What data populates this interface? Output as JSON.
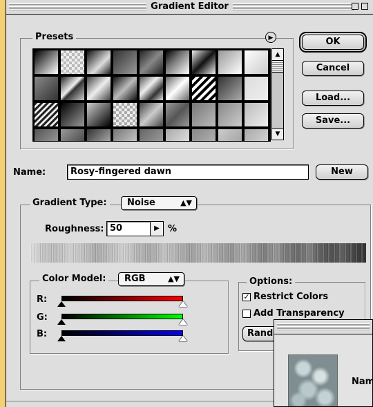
{
  "window": {
    "title": "Gradient Editor"
  },
  "presets": {
    "label": "Presets",
    "menu_icon": "circle-arrow-icon"
  },
  "buttons": {
    "ok": "OK",
    "cancel": "Cancel",
    "load": "Load...",
    "save": "Save...",
    "new": "New"
  },
  "name": {
    "label": "Name:",
    "value": "Rosy-fingered dawn"
  },
  "gradient_type": {
    "label": "Gradient Type:",
    "value": "Noise"
  },
  "roughness": {
    "label": "Roughness:",
    "value": "50",
    "unit": "%"
  },
  "color_model": {
    "label": "Color Model:",
    "value": "RGB",
    "channels": [
      {
        "label": "R:",
        "gradient": [
          "#000000",
          "#ff0000"
        ]
      },
      {
        "label": "G:",
        "gradient": [
          "#000000",
          "#00ff00"
        ]
      },
      {
        "label": "B:",
        "gradient": [
          "#000000",
          "#0000ff"
        ]
      }
    ]
  },
  "options": {
    "label": "Options:",
    "restrict_colors": {
      "label": "Restrict Colors",
      "checked": true
    },
    "add_transparency": {
      "label": "Add Transparency",
      "checked": false
    },
    "randomize": "Randomize"
  },
  "overlay_dialog": {
    "name_label": "Name"
  },
  "colors": {
    "desktop": "#f4cf76",
    "window_bg": "#dedede"
  }
}
